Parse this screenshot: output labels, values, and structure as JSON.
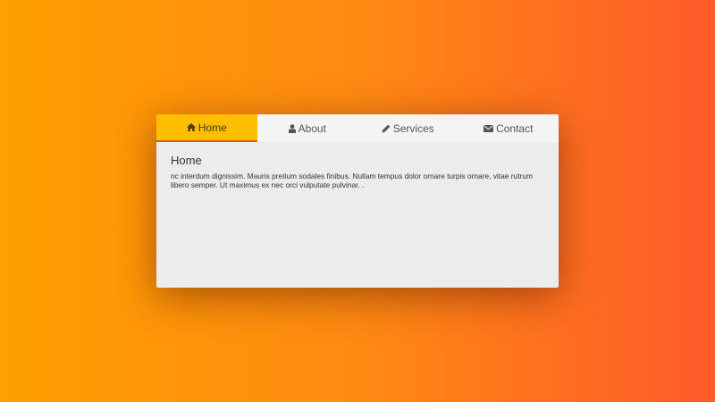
{
  "colors": {
    "background_start": "#ff9f00",
    "background_end": "#ff5a2a",
    "active_tab": "#ffbf00",
    "active_underline": "#e25b1a",
    "card": "#ececec"
  },
  "tabs": [
    {
      "label": "Home",
      "icon": "home-icon",
      "active": true
    },
    {
      "label": "About",
      "icon": "user-icon",
      "active": false
    },
    {
      "label": "Services",
      "icon": "pencil-icon",
      "active": false
    },
    {
      "label": "Contact",
      "icon": "envelope-icon",
      "active": false
    }
  ],
  "panel": {
    "title": "Home",
    "body": "nc interdum dignissim. Mauris pretium sodales finibus. Nullam tempus dolor ornare turpis ornare, vitae rutrum libero semper. Ut maximus ex nec orci vulputate pulvinar. ."
  }
}
